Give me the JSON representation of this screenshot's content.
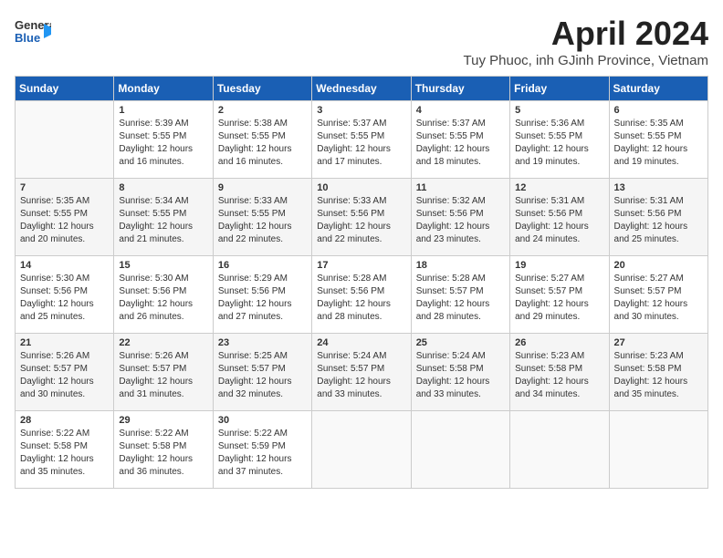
{
  "logo": {
    "line1": "General",
    "line2": "Blue"
  },
  "title": "April 2024",
  "subtitle": "Tuy Phuoc, inh GJinh Province, Vietnam",
  "days_header": [
    "Sunday",
    "Monday",
    "Tuesday",
    "Wednesday",
    "Thursday",
    "Friday",
    "Saturday"
  ],
  "weeks": [
    [
      {
        "day": "",
        "sunrise": "",
        "sunset": "",
        "daylight": ""
      },
      {
        "day": "1",
        "sunrise": "5:39 AM",
        "sunset": "5:55 PM",
        "daylight": "12 hours and 16 minutes."
      },
      {
        "day": "2",
        "sunrise": "5:38 AM",
        "sunset": "5:55 PM",
        "daylight": "12 hours and 16 minutes."
      },
      {
        "day": "3",
        "sunrise": "5:37 AM",
        "sunset": "5:55 PM",
        "daylight": "12 hours and 17 minutes."
      },
      {
        "day": "4",
        "sunrise": "5:37 AM",
        "sunset": "5:55 PM",
        "daylight": "12 hours and 18 minutes."
      },
      {
        "day": "5",
        "sunrise": "5:36 AM",
        "sunset": "5:55 PM",
        "daylight": "12 hours and 19 minutes."
      },
      {
        "day": "6",
        "sunrise": "5:35 AM",
        "sunset": "5:55 PM",
        "daylight": "12 hours and 19 minutes."
      }
    ],
    [
      {
        "day": "7",
        "sunrise": "5:35 AM",
        "sunset": "5:55 PM",
        "daylight": "12 hours and 20 minutes."
      },
      {
        "day": "8",
        "sunrise": "5:34 AM",
        "sunset": "5:55 PM",
        "daylight": "12 hours and 21 minutes."
      },
      {
        "day": "9",
        "sunrise": "5:33 AM",
        "sunset": "5:55 PM",
        "daylight": "12 hours and 22 minutes."
      },
      {
        "day": "10",
        "sunrise": "5:33 AM",
        "sunset": "5:56 PM",
        "daylight": "12 hours and 22 minutes."
      },
      {
        "day": "11",
        "sunrise": "5:32 AM",
        "sunset": "5:56 PM",
        "daylight": "12 hours and 23 minutes."
      },
      {
        "day": "12",
        "sunrise": "5:31 AM",
        "sunset": "5:56 PM",
        "daylight": "12 hours and 24 minutes."
      },
      {
        "day": "13",
        "sunrise": "5:31 AM",
        "sunset": "5:56 PM",
        "daylight": "12 hours and 25 minutes."
      }
    ],
    [
      {
        "day": "14",
        "sunrise": "5:30 AM",
        "sunset": "5:56 PM",
        "daylight": "12 hours and 25 minutes."
      },
      {
        "day": "15",
        "sunrise": "5:30 AM",
        "sunset": "5:56 PM",
        "daylight": "12 hours and 26 minutes."
      },
      {
        "day": "16",
        "sunrise": "5:29 AM",
        "sunset": "5:56 PM",
        "daylight": "12 hours and 27 minutes."
      },
      {
        "day": "17",
        "sunrise": "5:28 AM",
        "sunset": "5:56 PM",
        "daylight": "12 hours and 28 minutes."
      },
      {
        "day": "18",
        "sunrise": "5:28 AM",
        "sunset": "5:57 PM",
        "daylight": "12 hours and 28 minutes."
      },
      {
        "day": "19",
        "sunrise": "5:27 AM",
        "sunset": "5:57 PM",
        "daylight": "12 hours and 29 minutes."
      },
      {
        "day": "20",
        "sunrise": "5:27 AM",
        "sunset": "5:57 PM",
        "daylight": "12 hours and 30 minutes."
      }
    ],
    [
      {
        "day": "21",
        "sunrise": "5:26 AM",
        "sunset": "5:57 PM",
        "daylight": "12 hours and 30 minutes."
      },
      {
        "day": "22",
        "sunrise": "5:26 AM",
        "sunset": "5:57 PM",
        "daylight": "12 hours and 31 minutes."
      },
      {
        "day": "23",
        "sunrise": "5:25 AM",
        "sunset": "5:57 PM",
        "daylight": "12 hours and 32 minutes."
      },
      {
        "day": "24",
        "sunrise": "5:24 AM",
        "sunset": "5:57 PM",
        "daylight": "12 hours and 33 minutes."
      },
      {
        "day": "25",
        "sunrise": "5:24 AM",
        "sunset": "5:58 PM",
        "daylight": "12 hours and 33 minutes."
      },
      {
        "day": "26",
        "sunrise": "5:23 AM",
        "sunset": "5:58 PM",
        "daylight": "12 hours and 34 minutes."
      },
      {
        "day": "27",
        "sunrise": "5:23 AM",
        "sunset": "5:58 PM",
        "daylight": "12 hours and 35 minutes."
      }
    ],
    [
      {
        "day": "28",
        "sunrise": "5:22 AM",
        "sunset": "5:58 PM",
        "daylight": "12 hours and 35 minutes."
      },
      {
        "day": "29",
        "sunrise": "5:22 AM",
        "sunset": "5:58 PM",
        "daylight": "12 hours and 36 minutes."
      },
      {
        "day": "30",
        "sunrise": "5:22 AM",
        "sunset": "5:59 PM",
        "daylight": "12 hours and 37 minutes."
      },
      {
        "day": "",
        "sunrise": "",
        "sunset": "",
        "daylight": ""
      },
      {
        "day": "",
        "sunrise": "",
        "sunset": "",
        "daylight": ""
      },
      {
        "day": "",
        "sunrise": "",
        "sunset": "",
        "daylight": ""
      },
      {
        "day": "",
        "sunrise": "",
        "sunset": "",
        "daylight": ""
      }
    ]
  ]
}
